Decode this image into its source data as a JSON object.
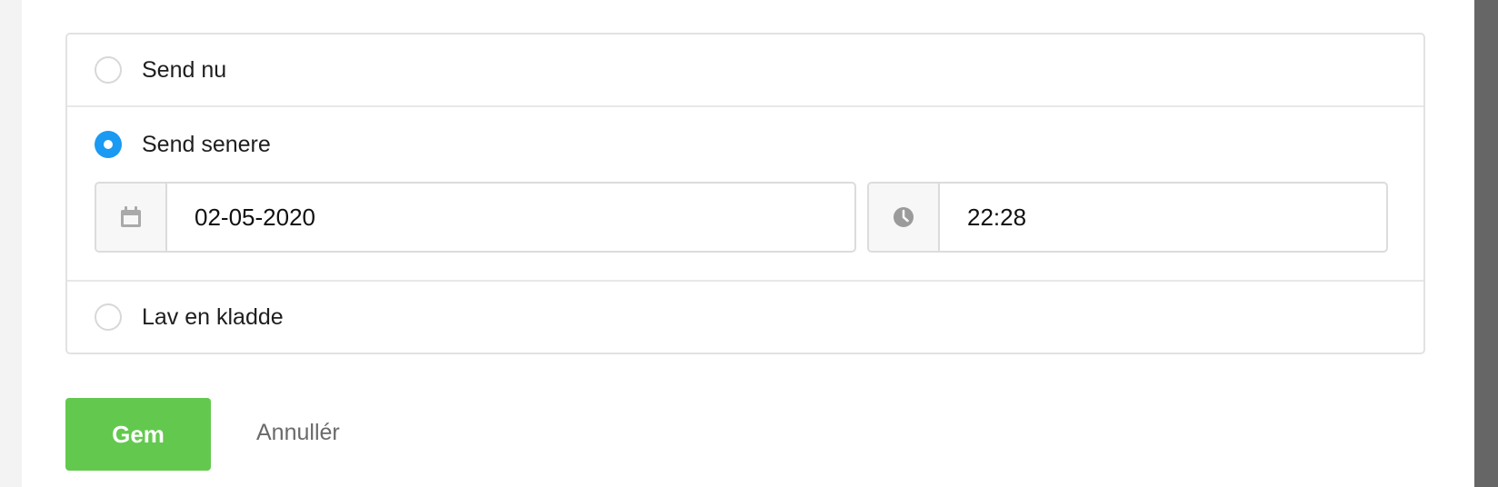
{
  "schedule": {
    "options": [
      {
        "label": "Send nu",
        "checked": false
      },
      {
        "label": "Send senere",
        "checked": true
      },
      {
        "label": "Lav en kladde",
        "checked": false
      }
    ],
    "date_value": "02-05-2020",
    "time_value": "22:28"
  },
  "actions": {
    "save_label": "Gem",
    "cancel_label": "Annullér"
  },
  "icons": {
    "date": "calendar-icon",
    "time": "clock-icon"
  },
  "colors": {
    "accent": "#1a9af2",
    "save_button": "#62c94e"
  }
}
